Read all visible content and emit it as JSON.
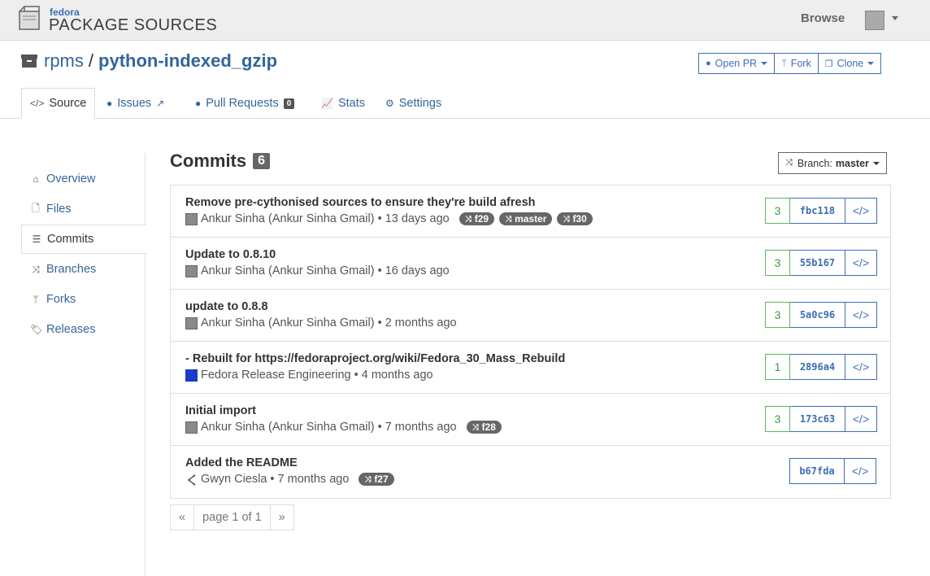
{
  "topbar": {
    "logo_small": "fedora",
    "logo_big": "PACKAGE SOURCES",
    "browse_label": "Browse"
  },
  "repo": {
    "namespace": "rpms",
    "separator": "/",
    "name": "python-indexed_gzip",
    "actions": {
      "open_pr": "Open PR",
      "fork": "Fork",
      "clone": "Clone"
    }
  },
  "tabs": [
    {
      "label": "Source"
    },
    {
      "label": "Issues"
    },
    {
      "label": "Pull Requests",
      "count": "0"
    },
    {
      "label": "Stats"
    },
    {
      "label": "Settings"
    }
  ],
  "sidebar": {
    "items": [
      {
        "label": "Overview"
      },
      {
        "label": "Files"
      },
      {
        "label": "Commits"
      },
      {
        "label": "Branches"
      },
      {
        "label": "Forks"
      },
      {
        "label": "Releases"
      }
    ]
  },
  "commits": {
    "title": "Commits",
    "count": "6",
    "branch_prefix": "Branch:",
    "branch": "master",
    "items": [
      {
        "message": "Remove pre-cythonised sources to ensure they're build afresh",
        "author": "Ankur Sinha (Ankur Sinha Gmail)",
        "when": "• 13 days ago",
        "tags": [
          "f29",
          "master",
          "f30"
        ],
        "count": "3",
        "hash": "fbc118"
      },
      {
        "message": "Update to 0.8.10",
        "author": "Ankur Sinha (Ankur Sinha Gmail)",
        "when": "• 16 days ago",
        "tags": [],
        "count": "3",
        "hash": "55b167"
      },
      {
        "message": "update to 0.8.8",
        "author": "Ankur Sinha (Ankur Sinha Gmail)",
        "when": "• 2 months ago",
        "tags": [],
        "count": "3",
        "hash": "5a0c96"
      },
      {
        "message": "- Rebuilt for https://fedoraproject.org/wiki/Fedora_30_Mass_Rebuild",
        "author": "Fedora Release Engineering",
        "when": "• 4 months ago",
        "tags": [],
        "count": "1",
        "hash": "2896a4"
      },
      {
        "message": "Initial import",
        "author": "Ankur Sinha (Ankur Sinha Gmail)",
        "when": "• 7 months ago",
        "tags": [
          "f28"
        ],
        "count": "3",
        "hash": "173c63"
      },
      {
        "message": "Added the README",
        "author": "Gwyn Ciesla",
        "when": "• 7 months ago",
        "tags": [
          "f27"
        ],
        "count": "",
        "hash": "b67fda"
      }
    ]
  },
  "pager": {
    "prev": "«",
    "label": "page 1 of 1",
    "next": "»"
  },
  "colors": {
    "link": "#336699",
    "accent": "#3c6eb4",
    "count_green": "#3c9a3c",
    "tag_bg": "#666666"
  }
}
